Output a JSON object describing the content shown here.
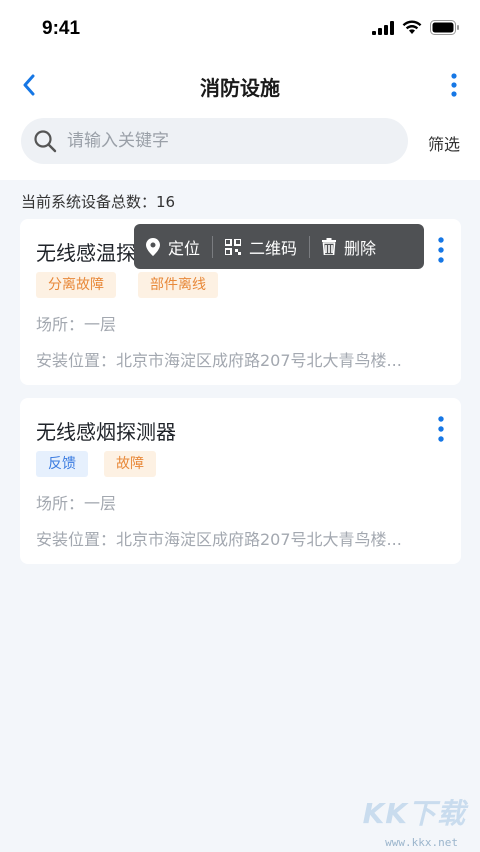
{
  "status_bar": {
    "time": "9:41"
  },
  "nav": {
    "title": "消防设施"
  },
  "search": {
    "placeholder": "请输入关键字",
    "filter_label": "筛选"
  },
  "summary": {
    "count_text": "当前系统设备总数：16"
  },
  "devices": [
    {
      "name": "无线感温探",
      "tags": [
        {
          "label": "分离故障",
          "color": "#e8893a"
        },
        {
          "label": "部件离线",
          "color": "#e8893a"
        }
      ],
      "location": "场所：一层",
      "install": "安装位置：北京市海淀区成府路207号北大青鸟楼..."
    },
    {
      "name": "无线感烟探测器",
      "tags": [
        {
          "label": "反馈",
          "color": "#3a7be0"
        },
        {
          "label": "故障",
          "color": "#e8893a"
        }
      ],
      "location": "场所：一层",
      "install": "安装位置：北京市海淀区成府路207号北大青鸟楼..."
    }
  ],
  "context_menu": {
    "items": [
      {
        "label": "定位",
        "icon": "location-pin-icon"
      },
      {
        "label": "二维码",
        "icon": "qr-code-icon"
      },
      {
        "label": "删除",
        "icon": "trash-icon"
      }
    ]
  },
  "watermark": {
    "brand": "KK下载",
    "url": "www.kkx.net"
  },
  "colors": {
    "accent": "#1677e5",
    "menu_bg": "#4f5154",
    "page_bg": "#f3f6fa"
  }
}
